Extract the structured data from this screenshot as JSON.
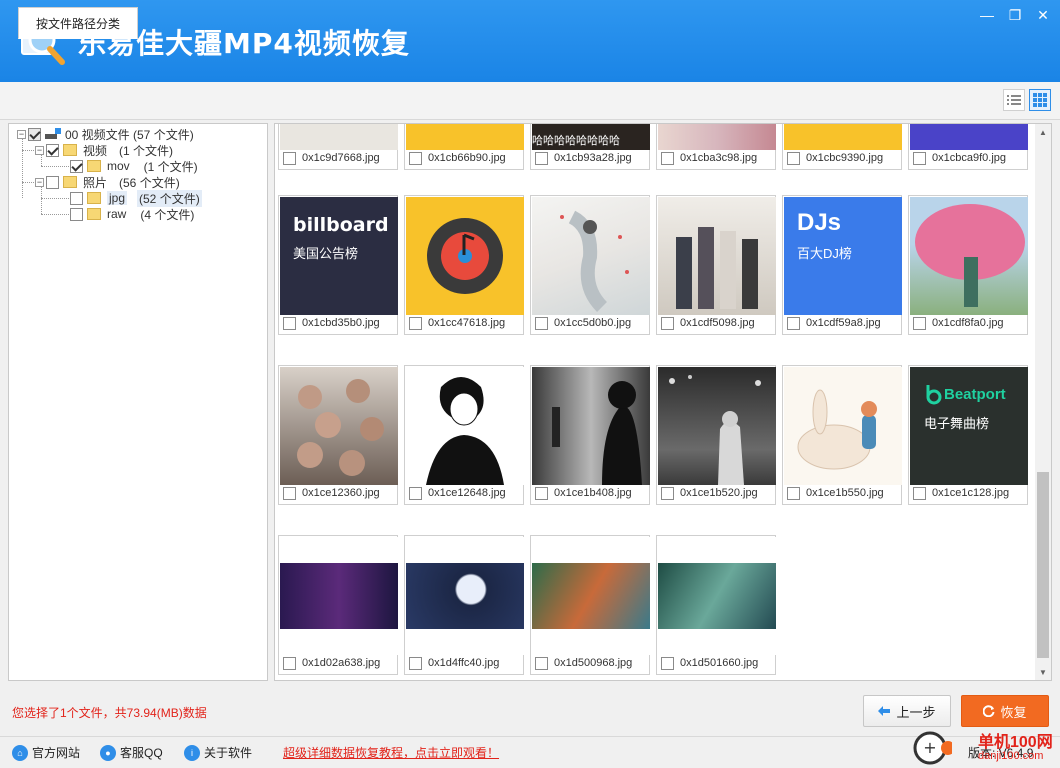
{
  "window": {
    "title": "乐易佳大疆MP4视频恢复",
    "controls": [
      "minimize-icon",
      "restore-icon",
      "close-icon"
    ]
  },
  "tabs": [
    {
      "label": "按文件路径分类"
    }
  ],
  "tree": {
    "items": [
      {
        "label": "00 视频文件 (57 个文件)",
        "checked": true
      },
      {
        "label": "视频",
        "count": "(1 个文件)",
        "checked": true
      },
      {
        "label": "mov",
        "count": "(1 个文件)",
        "checked": true
      },
      {
        "label": "照片",
        "count": "(56 个文件)",
        "checked": false
      },
      {
        "label": "jpg",
        "count": "(52 个文件)",
        "checked": false,
        "selected": true
      },
      {
        "label": "raw",
        "count": "(4 个文件)",
        "checked": false
      }
    ]
  },
  "files": {
    "row0": [
      "0x1c9d7668.jpg",
      "0x1cb66b90.jpg",
      "0x1cb93a28.jpg",
      "0x1cba3c98.jpg",
      "0x1cbc9390.jpg",
      "0x1cbca9f0.jpg"
    ],
    "row1": [
      "0x1cbd35b0.jpg",
      "0x1cc47618.jpg",
      "0x1cc5d0b0.jpg",
      "0x1cdf5098.jpg",
      "0x1cdf59a8.jpg",
      "0x1cdf8fa0.jpg"
    ],
    "row2": [
      "0x1ce12360.jpg",
      "0x1ce12648.jpg",
      "0x1ce1b408.jpg",
      "0x1ce1b520.jpg",
      "0x1ce1b550.jpg",
      "0x1ce1c128.jpg"
    ],
    "row3": [
      "0x1d02a638.jpg",
      "0x1d4ffc40.jpg",
      "0x1d500968.jpg",
      "0x1d501660.jpg"
    ]
  },
  "thumb_text": {
    "haha": "哈哈哈哈哈哈哈哈",
    "billboard": "billboard",
    "billboard_cn": "美国公告榜",
    "dj": "DJs",
    "dj_cn": "百大DJ榜",
    "beatport": "Beatport",
    "beatport_cn": "电子舞曲榜"
  },
  "status": "您选择了1个文件，共73.94(MB)数据",
  "buttons": {
    "prev": "上一步",
    "restore": "恢复"
  },
  "footer": {
    "website": "官方网站",
    "qq": "客服QQ",
    "about": "关于软件",
    "promo": "超级详细数据恢复教程，点击立即观看！",
    "version": "版本: V6.4.9"
  },
  "watermark": {
    "text1": "单机100网",
    "text2": "danji100.com"
  },
  "colors": {
    "titlebar": "#1a84e6",
    "accent_orange": "#f26a21",
    "status_red": "#e2231a",
    "billboard_bg": "#2b2d42",
    "yellow": "#f8c22a",
    "dj_blue": "#3a7bea",
    "beatport_bg": "#2a302d"
  }
}
